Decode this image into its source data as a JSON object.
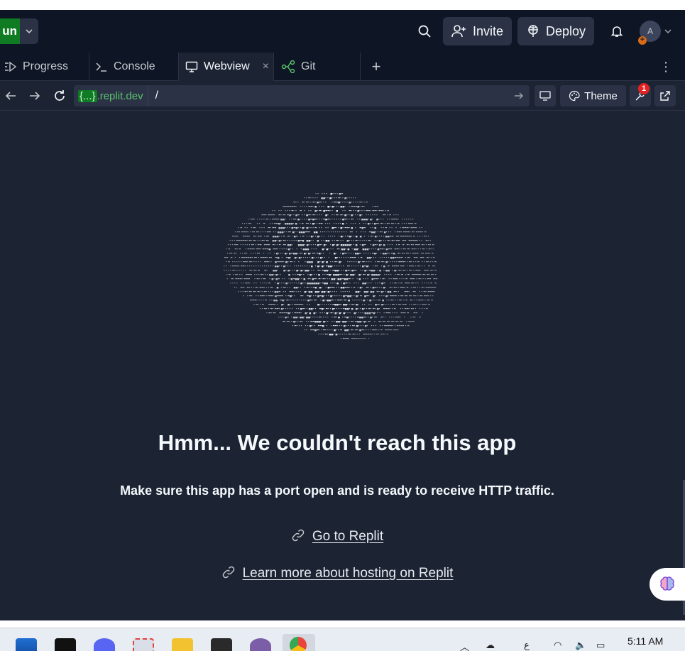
{
  "header": {
    "run_label": "un",
    "invite_label": "Invite",
    "deploy_label": "Deploy",
    "avatar_initial": "A",
    "avatar_badge": "+"
  },
  "tabs": [
    {
      "label": "Progress",
      "icon": "progress-icon"
    },
    {
      "label": "Console",
      "icon": "console-icon"
    },
    {
      "label": "Webview",
      "icon": "monitor-icon",
      "active": true
    },
    {
      "label": "Git",
      "icon": "git-icon"
    }
  ],
  "tab_add": "+",
  "tab_more": "⋮",
  "tab_close": "×",
  "urlbar": {
    "host_braces": "{...}",
    "host_suffix": ".replit.dev",
    "path": "/",
    "theme_label": "Theme",
    "devtools_badge": "1"
  },
  "webview": {
    "title": "Hmm... We couldn't reach this app",
    "subtitle": "Make sure this app has a port open and is ready to receive HTTP traffic.",
    "link_replit": "Go to Replit",
    "link_hosting": "Learn more about hosting on Replit"
  },
  "taskbar": {
    "time": "5:11 AM",
    "lang": "ع"
  },
  "colors": {
    "background": "#1c2333",
    "header": "#0e1525",
    "run_green": "#0f7b22",
    "notification_red": "#e52222",
    "url_green": "#5ac26d"
  }
}
